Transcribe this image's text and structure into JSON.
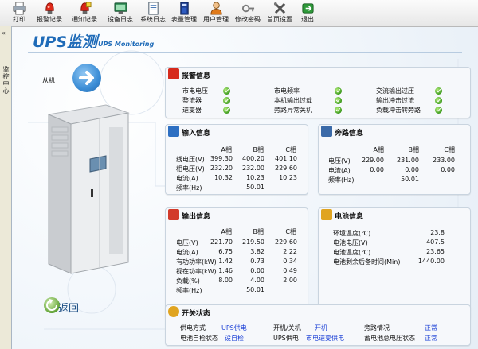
{
  "toolbar": {
    "items": [
      {
        "label": "打印",
        "icon": "printer-icon"
      },
      {
        "label": "报警记录",
        "icon": "alarm-record-icon"
      },
      {
        "label": "通知记录",
        "icon": "notice-record-icon"
      },
      {
        "label": "设备日志",
        "icon": "device-log-icon"
      },
      {
        "label": "系统日志",
        "icon": "system-log-icon"
      },
      {
        "label": "表量管理",
        "icon": "meter-manage-icon"
      },
      {
        "label": "用户管理",
        "icon": "user-manage-icon"
      },
      {
        "label": "修改密码",
        "icon": "password-icon"
      },
      {
        "label": "首页设置",
        "icon": "home-settings-icon"
      },
      {
        "label": "退出",
        "icon": "exit-icon"
      }
    ]
  },
  "left_strip": {
    "label": "监控中心",
    "chevron": "«"
  },
  "page": {
    "title": "UPS监测",
    "subtitle": "UPS Monitoring",
    "mode_label": "从机",
    "back_label": "返回"
  },
  "alarm": {
    "title": "报警信息",
    "col1": [
      "市电电压",
      "整流器",
      "逆变器"
    ],
    "col2": [
      "市电频率",
      "本机输出过载",
      "旁路异常关机"
    ],
    "col3": [
      "交流输出过压",
      "输出冲击过流",
      "负载冲击转旁路"
    ]
  },
  "input": {
    "title": "输入信息",
    "headers": [
      "A相",
      "B相",
      "C相"
    ],
    "rows": [
      {
        "label": "线电压(V)",
        "values": [
          "399.30",
          "400.20",
          "401.10"
        ]
      },
      {
        "label": "相电压(V)",
        "values": [
          "232.20",
          "232.00",
          "229.60"
        ]
      },
      {
        "label": "电流(A)",
        "values": [
          "10.32",
          "10.23",
          "10.23"
        ]
      },
      {
        "label": "频率(Hz)",
        "values": [
          "",
          "50.01",
          ""
        ]
      }
    ]
  },
  "bypass": {
    "title": "旁路信息",
    "headers": [
      "A相",
      "B相",
      "C相"
    ],
    "rows": [
      {
        "label": "电压(V)",
        "values": [
          "229.00",
          "231.00",
          "233.00"
        ]
      },
      {
        "label": "电流(A)",
        "values": [
          "0.00",
          "0.00",
          "0.00"
        ]
      },
      {
        "label": "频率(Hz)",
        "values": [
          "",
          "50.01",
          ""
        ]
      }
    ]
  },
  "output": {
    "title": "输出信息",
    "headers": [
      "A相",
      "B相",
      "C相"
    ],
    "rows": [
      {
        "label": "电压(V)",
        "values": [
          "221.70",
          "219.50",
          "229.60"
        ]
      },
      {
        "label": "电流(A)",
        "values": [
          "6.75",
          "3.82",
          "2.22"
        ]
      },
      {
        "label": "有功功率(kW)",
        "values": [
          "1.42",
          "0.73",
          "0.34"
        ]
      },
      {
        "label": "视在功率(kW)",
        "values": [
          "1.46",
          "0.00",
          "0.49"
        ]
      },
      {
        "label": "负载(%)",
        "values": [
          "8.00",
          "4.00",
          "2.00"
        ]
      },
      {
        "label": "频率(Hz)",
        "values": [
          "",
          "50.01",
          ""
        ]
      }
    ]
  },
  "battery": {
    "title": "电池信息",
    "rows": [
      {
        "label": "环境温度(℃)",
        "value": "23.8"
      },
      {
        "label": "电池电压(V)",
        "value": "407.5"
      },
      {
        "label": "电池温度(℃)",
        "value": "23.65"
      },
      {
        "label": "电池剩余后备时间(Min)",
        "value": "1440.00"
      }
    ]
  },
  "switch": {
    "title": "开关状态",
    "items": [
      {
        "label": "供电方式",
        "value": "UPS供电"
      },
      {
        "label": "开机/关机",
        "value": "开机"
      },
      {
        "label": "旁路情况",
        "value": "正常"
      },
      {
        "label": "电池自检状态",
        "value": "设自检"
      },
      {
        "label": "UPS供电",
        "value": "市电逆变供电"
      },
      {
        "label": "蓄电池总电压状态",
        "value": "正常"
      }
    ]
  },
  "colors": {
    "accent": "#1f6bb8",
    "ok": "#3c9a1c",
    "status_value": "#1a3fd6"
  }
}
